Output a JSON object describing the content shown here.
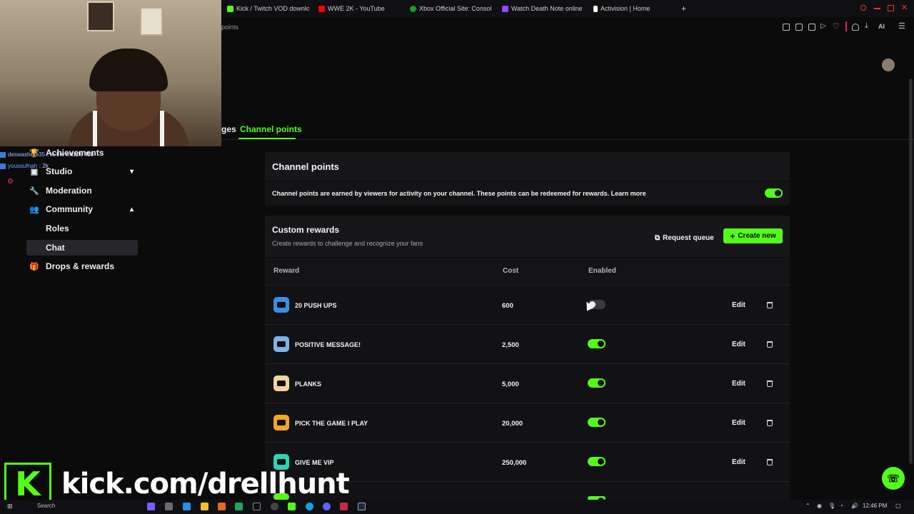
{
  "browser": {
    "tabs": [
      {
        "label": "Kick / Twitch VOD downlo",
        "icon": "kick-icon",
        "color": "#53fc18"
      },
      {
        "label": "WWE 2K - YouTube",
        "icon": "youtube-icon",
        "color": "#ff0000"
      },
      {
        "label": "Xbox Official Site: Consol",
        "icon": "xbox-icon",
        "color": "#1c9b1c"
      },
      {
        "label": "Watch Death Note online f",
        "icon": "play-icon",
        "color": "#9146ff"
      },
      {
        "label": "Activision | Home",
        "icon": "activision-icon",
        "color": "#ffffff"
      }
    ],
    "new_tab": "+",
    "url_fragment": "points"
  },
  "chat_overlay": {
    "lines": [
      {
        "user": "deswashere35",
        "text": ": in the middle 450"
      },
      {
        "user": "youssufnah",
        "text": ": 2k"
      }
    ]
  },
  "sidebar": {
    "items": [
      {
        "label": "Achievements",
        "icon": "trophy-icon"
      },
      {
        "label": "Studio",
        "icon": "studio-icon",
        "chevron": "▾"
      },
      {
        "label": "Moderation",
        "icon": "wrench-icon"
      },
      {
        "label": "Community",
        "icon": "community-icon",
        "chevron": "▴"
      },
      {
        "label": "Drops & rewards",
        "icon": "gift-icon"
      }
    ],
    "sub_items": [
      {
        "label": "Roles"
      },
      {
        "label": "Chat"
      }
    ]
  },
  "page_tabs": {
    "partial": "ges",
    "active": "Channel points"
  },
  "channel_points": {
    "title": "Channel points",
    "description": "Channel points are earned by viewers for activity on your channel. These points can be redeemed for rewards.",
    "learn_more": "Learn more",
    "enabled": true
  },
  "custom_rewards": {
    "title": "Custom rewards",
    "subtitle": "Create rewards to challenge and recognize your fans",
    "request_queue": "Request queue",
    "create_new": "Create new",
    "columns": [
      "Reward",
      "Cost",
      "Enabled"
    ],
    "edit_label": "Edit",
    "rows": [
      {
        "name": "20 PUSH UPS",
        "cost": "600",
        "enabled": false,
        "color": "#3a8ee6"
      },
      {
        "name": "POSITIVE MESSAGE!",
        "cost": "2,500",
        "enabled": true,
        "color": "#7fb2e8"
      },
      {
        "name": "PLANKS",
        "cost": "5,000",
        "enabled": true,
        "color": "#f5d59a"
      },
      {
        "name": "PICK THE GAME I PLAY",
        "cost": "20,000",
        "enabled": true,
        "color": "#f2a623"
      },
      {
        "name": "GIVE ME VIP",
        "cost": "250,000",
        "enabled": true,
        "color": "#2ed3b7"
      }
    ]
  },
  "overlay_banner": {
    "logo_letter": "K",
    "url": "kick.com/drellhunt"
  },
  "taskbar": {
    "search": "Search",
    "time": "12:46 PM"
  },
  "colors": {
    "accent": "#53fc18",
    "background": "#0b0b0c",
    "panel": "#17171a"
  }
}
